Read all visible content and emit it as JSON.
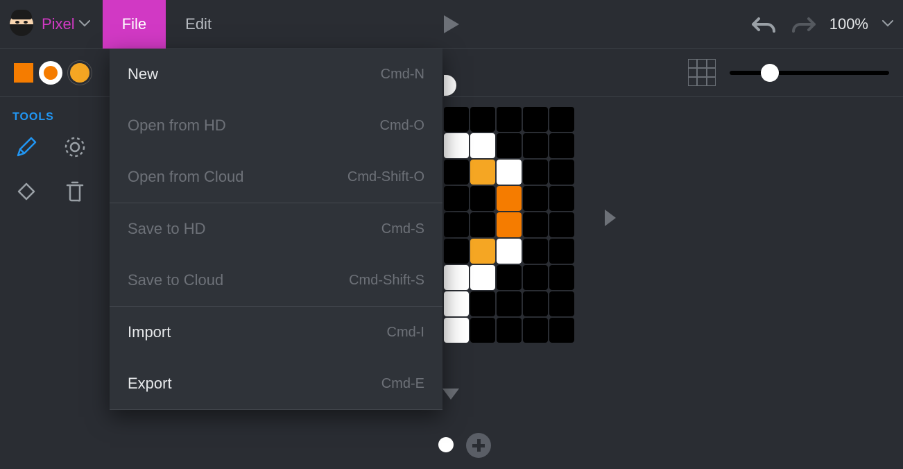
{
  "topbar": {
    "mode_label": "Pixel",
    "menu": {
      "file": "File",
      "edit": "Edit"
    },
    "zoom": "100%"
  },
  "tools": {
    "title": "TOOLS"
  },
  "file_menu": {
    "items": [
      {
        "label": "New",
        "shortcut": "Cmd-N",
        "enabled": true
      },
      {
        "label": "Open from HD",
        "shortcut": "Cmd-O",
        "enabled": false
      },
      {
        "label": "Open from Cloud",
        "shortcut": "Cmd-Shift-O",
        "enabled": false
      },
      {
        "label": "Save to HD",
        "shortcut": "Cmd-S",
        "enabled": false
      },
      {
        "label": "Save to Cloud",
        "shortcut": "Cmd-Shift-S",
        "enabled": false
      },
      {
        "label": "Import",
        "shortcut": "Cmd-I",
        "enabled": true
      },
      {
        "label": "Export",
        "shortcut": "Cmd-E",
        "enabled": true
      }
    ]
  },
  "colors": {
    "swatch1": "#f57c00",
    "swatch2_inner": "#f57c00",
    "swatch3": "#f5a623"
  },
  "pixel_canvas": {
    "cols": 5,
    "rows": 9,
    "cells": [
      "k",
      "k",
      "k",
      "k",
      "k",
      "w",
      "w",
      "k",
      "k",
      "k",
      "k",
      "y",
      "w",
      "k",
      "k",
      "k",
      "k",
      "o",
      "k",
      "k",
      "k",
      "k",
      "o",
      "k",
      "k",
      "k",
      "y",
      "w",
      "k",
      "k",
      "w",
      "w",
      "k",
      "k",
      "k",
      "w",
      "k",
      "k",
      "k",
      "k",
      "w",
      "k",
      "k",
      "k",
      "k"
    ]
  }
}
